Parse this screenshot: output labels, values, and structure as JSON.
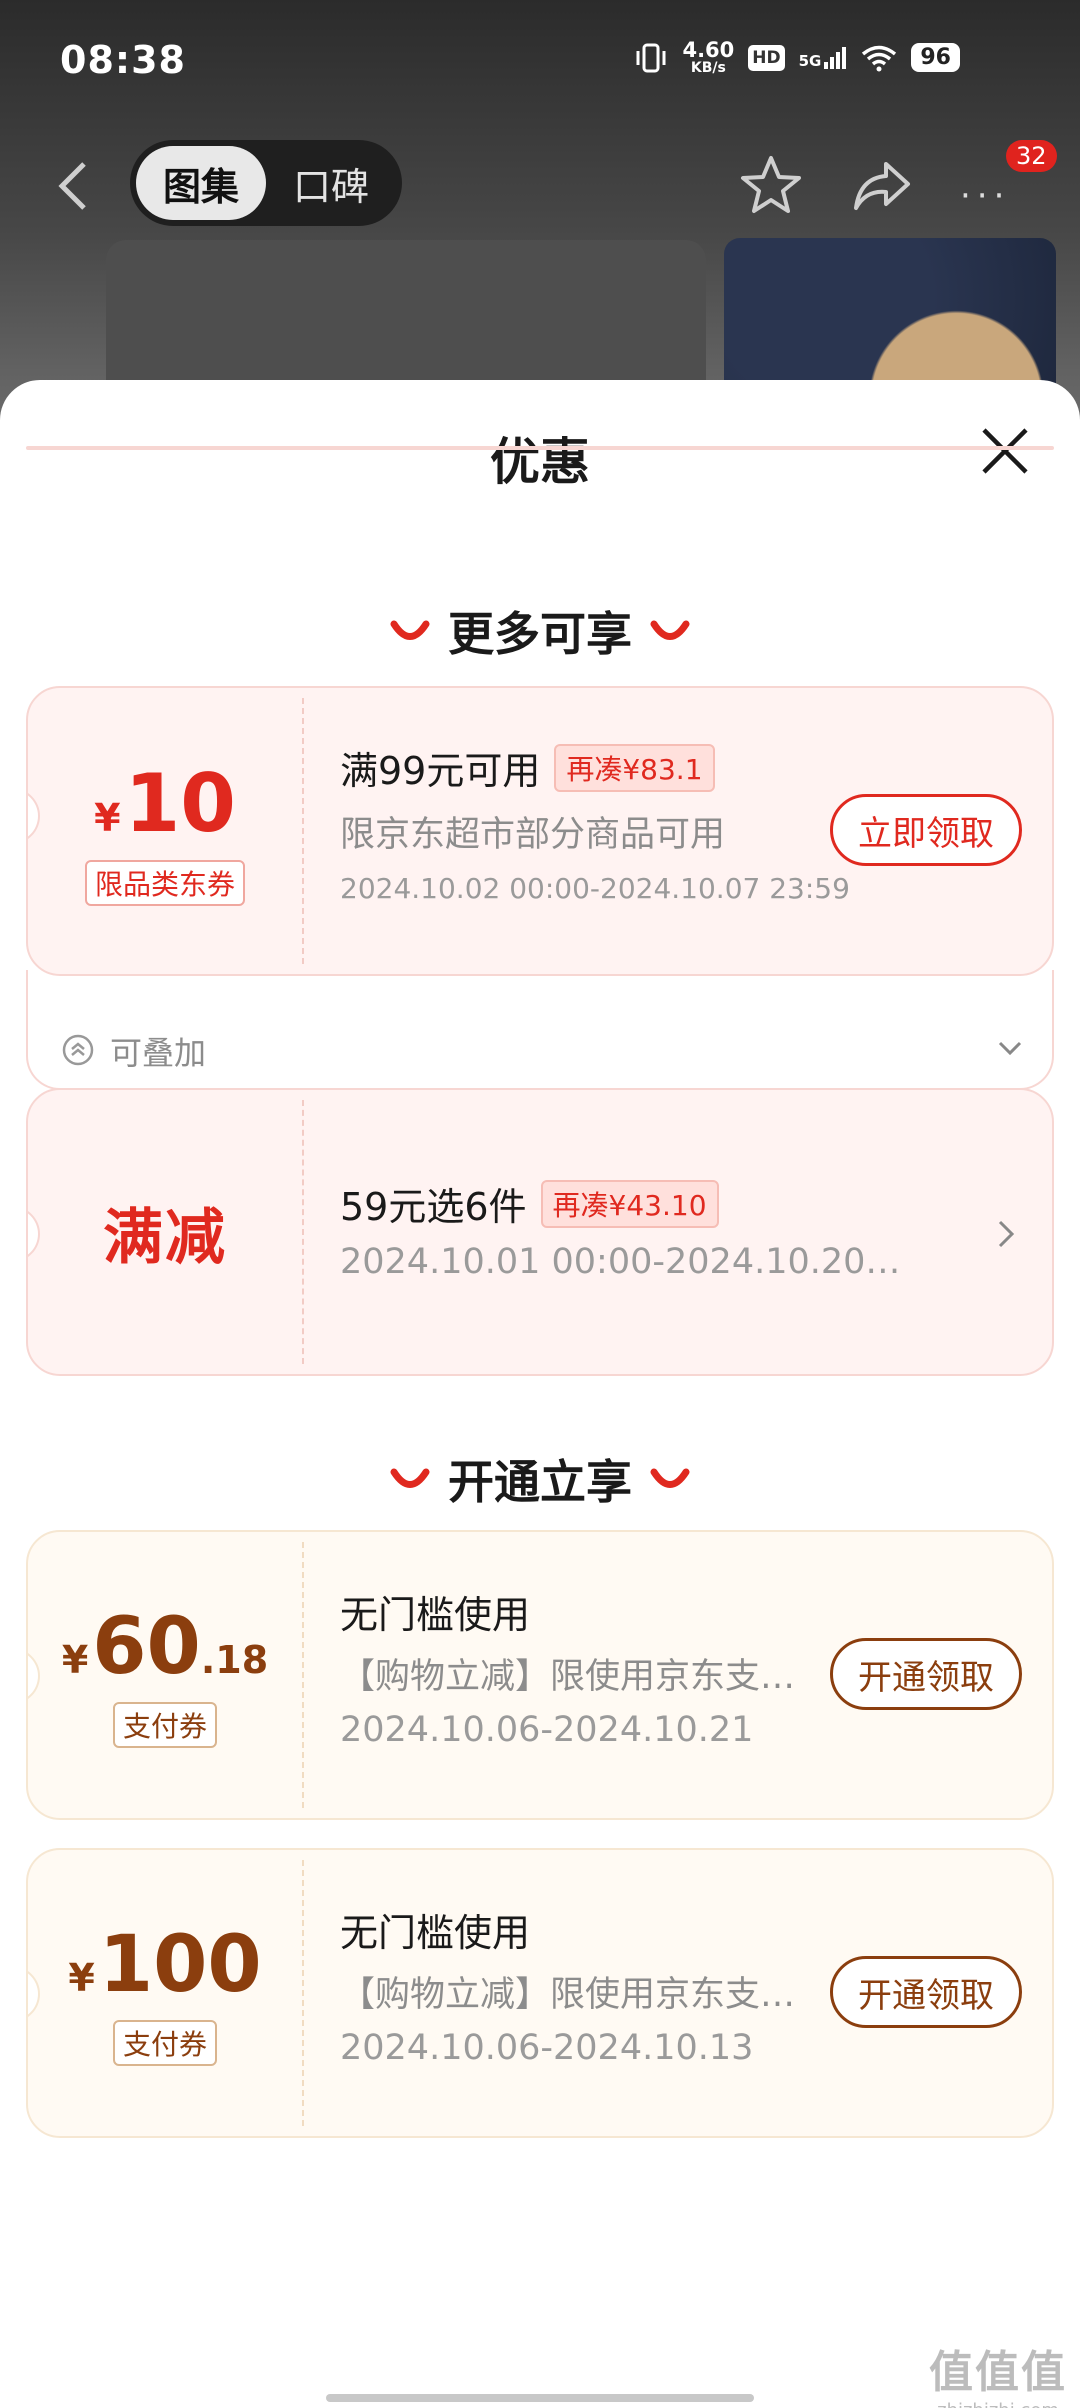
{
  "status_bar": {
    "time": "08:38",
    "net_speed_value": "4.60",
    "net_speed_unit": "KB/s",
    "hd": "HD",
    "network": "5G",
    "battery": "96"
  },
  "nav": {
    "tabs": [
      {
        "label": "图集",
        "active": true
      },
      {
        "label": "口碑",
        "active": false
      }
    ],
    "more": "···",
    "badge_count": "32"
  },
  "sheet": {
    "title": "优惠",
    "sections": [
      {
        "title": "更多可享"
      },
      {
        "title": "开通立享"
      }
    ]
  },
  "coupons": [
    {
      "currency": "¥",
      "amount": "10",
      "tag": "限品类东券",
      "title": "满99元可用",
      "pill": "再凑¥83.1",
      "subtitle": "限京东超市部分商品可用",
      "date": "2024.10.02 00:00-2024.10.07 23:59",
      "button": "立即领取",
      "stack_label": "可叠加"
    },
    {
      "label": "满减",
      "title": "59元选6件",
      "pill": "再凑¥43.10",
      "date": "2024.10.01 00:00-2024.10.20…"
    },
    {
      "currency": "¥",
      "amount": "60",
      "decimal": ".18",
      "tag": "支付券",
      "title": "无门槛使用",
      "subtitle": "【购物立减】限使用京东支…",
      "date": "2024.10.06-2024.10.21",
      "button": "开通领取"
    },
    {
      "currency": "¥",
      "amount": "100",
      "tag": "支付券",
      "title": "无门槛使用",
      "subtitle": "【购物立减】限使用京东支…",
      "date": "2024.10.06-2024.10.13",
      "button": "开通领取"
    }
  ],
  "watermark": {
    "big": "值值值",
    "small": "zhizhizhi.com"
  },
  "colors": {
    "accent_red": "#e0291f",
    "accent_gold": "#8b3e0e",
    "coupon_red_bg": "#fff3f2",
    "coupon_gold_bg": "#fffaf3"
  },
  "icons": [
    "back-arrow-icon",
    "star-icon",
    "share-icon",
    "more-icon",
    "close-icon",
    "smile-icon",
    "stack-icon",
    "chevron-down-icon",
    "chevron-right-icon"
  ]
}
